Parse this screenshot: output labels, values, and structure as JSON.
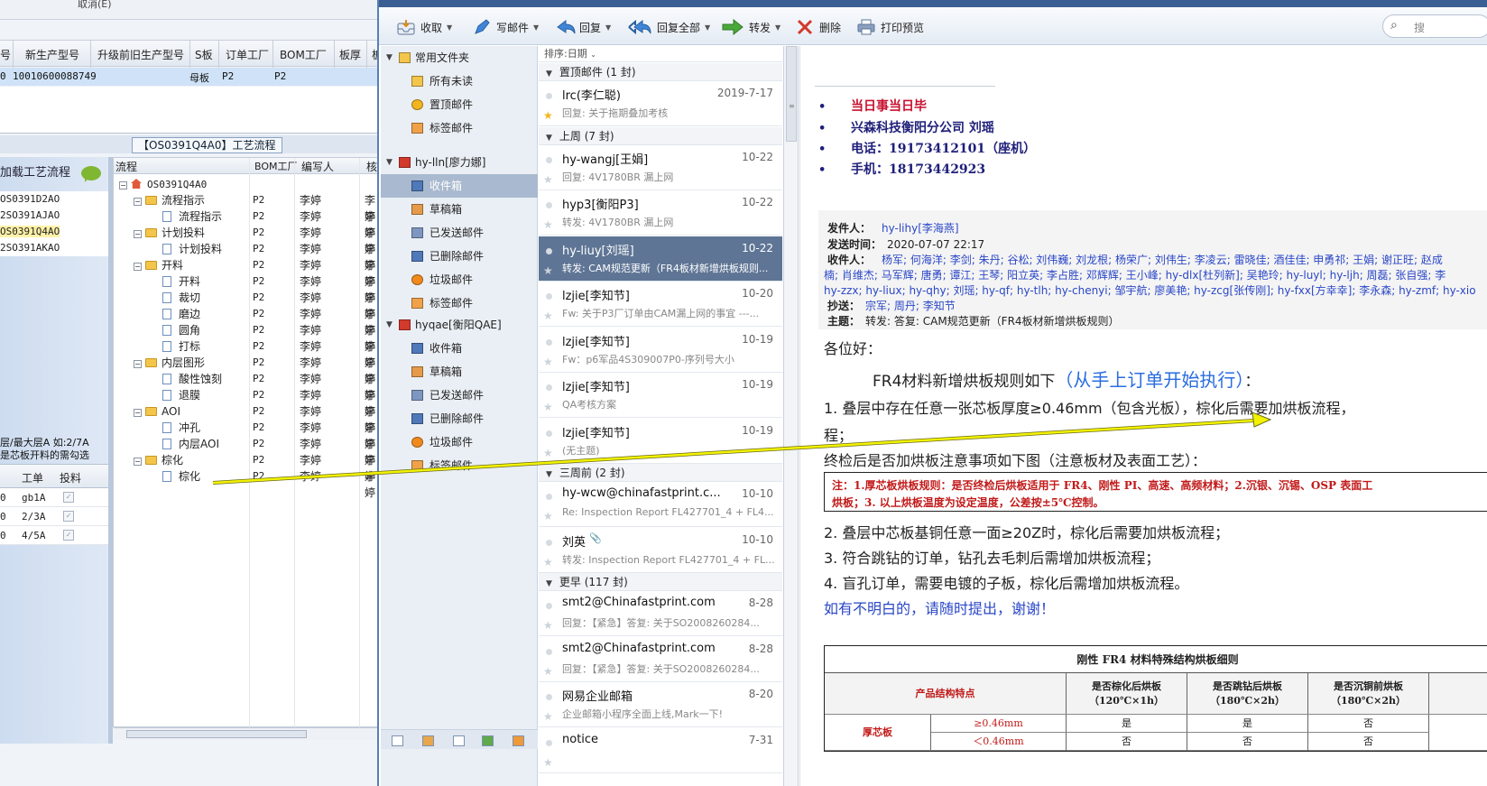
{
  "erp": {
    "top_cut_label": "取消(E)",
    "grid_headers": [
      "号",
      "新生产型号",
      "升级前旧生产型号",
      "S板",
      "订单工厂",
      "BOM工厂",
      "板厚",
      "板"
    ],
    "grid_row": {
      "c0": "0",
      "model": "10010600088749",
      "s_board": "母板",
      "order_factory": "P2",
      "bom_factory": "P2"
    },
    "process_title": "【OS0391Q4A0】工艺流程",
    "load_process_label": "加载工艺流程",
    "process_list": [
      "OS0391D2AO",
      "2SO391AJAO",
      "OS0391Q4AO",
      "2SO391AKAO"
    ],
    "selected_process": "OS0391Q4AO",
    "note_lines": [
      "层/最大层A 如:2/7A",
      "是芯板开料的需勾选"
    ],
    "layer_table": {
      "headers": [
        "工单",
        "投料"
      ],
      "rows": [
        {
          "c0": "0",
          "order": "gb1A",
          "check": "✓"
        },
        {
          "c0": "0",
          "order": "2/3A",
          "check": "✓"
        },
        {
          "c0": "0",
          "order": "4/5A",
          "check": "✓"
        }
      ]
    },
    "tree_headers": [
      "流程",
      "BOM工厂",
      "编写人",
      "核"
    ],
    "tree": [
      {
        "level": 0,
        "type": "root",
        "name": "OS0391Q4A0",
        "factory": "",
        "writer": "",
        "checker": ""
      },
      {
        "level": 1,
        "type": "folder",
        "name": "流程指示",
        "factory": "P2",
        "writer": "李婷",
        "checker": "李婷"
      },
      {
        "level": 2,
        "type": "doc",
        "name": "流程指示",
        "factory": "P2",
        "writer": "李婷",
        "checker": "李婷"
      },
      {
        "level": 1,
        "type": "folder",
        "name": "计划投料",
        "factory": "P2",
        "writer": "李婷",
        "checker": "李婷"
      },
      {
        "level": 2,
        "type": "doc",
        "name": "计划投料",
        "factory": "P2",
        "writer": "李婷",
        "checker": "李婷"
      },
      {
        "level": 1,
        "type": "folder",
        "name": "开料",
        "factory": "P2",
        "writer": "李婷",
        "checker": "李婷"
      },
      {
        "level": 2,
        "type": "doc",
        "name": "开料",
        "factory": "P2",
        "writer": "李婷",
        "checker": "李婷"
      },
      {
        "level": 2,
        "type": "doc",
        "name": "裁切",
        "factory": "P2",
        "writer": "李婷",
        "checker": "李婷"
      },
      {
        "level": 2,
        "type": "doc",
        "name": "磨边",
        "factory": "P2",
        "writer": "李婷",
        "checker": "李婷"
      },
      {
        "level": 2,
        "type": "doc",
        "name": "圆角",
        "factory": "P2",
        "writer": "李婷",
        "checker": "李婷"
      },
      {
        "level": 2,
        "type": "doc",
        "name": "打标",
        "factory": "P2",
        "writer": "李婷",
        "checker": "李婷"
      },
      {
        "level": 1,
        "type": "folder",
        "name": "内层图形",
        "factory": "P2",
        "writer": "李婷",
        "checker": "李婷"
      },
      {
        "level": 2,
        "type": "doc",
        "name": "酸性蚀刻",
        "factory": "P2",
        "writer": "李婷",
        "checker": "李婷"
      },
      {
        "level": 2,
        "type": "doc",
        "name": "退膜",
        "factory": "P2",
        "writer": "李婷",
        "checker": "李婷"
      },
      {
        "level": 1,
        "type": "folder",
        "name": "AOI",
        "factory": "P2",
        "writer": "李婷",
        "checker": "李婷"
      },
      {
        "level": 2,
        "type": "doc",
        "name": "冲孔",
        "factory": "P2",
        "writer": "李婷",
        "checker": "李婷"
      },
      {
        "level": 2,
        "type": "doc",
        "name": "内层AOI",
        "factory": "P2",
        "writer": "李婷",
        "checker": "李婷"
      },
      {
        "level": 1,
        "type": "folder",
        "name": "棕化",
        "factory": "P2",
        "writer": "李婷",
        "checker": "李婷"
      },
      {
        "level": 2,
        "type": "doc",
        "name": "棕化",
        "factory": "P2",
        "writer": "李婷",
        "checker": "李婷"
      }
    ]
  },
  "foxmail": {
    "title": "Foxmail",
    "toolbar": [
      {
        "name": "receive",
        "label": "收取",
        "icon": "inbox-tray-icon",
        "dropdown": true
      },
      {
        "name": "compose",
        "label": "写邮件",
        "icon": "pen-icon",
        "dropdown": true
      },
      {
        "name": "reply",
        "label": "回复",
        "icon": "reply-arrow-icon",
        "dropdown": true
      },
      {
        "name": "reply-all",
        "label": "回复全部",
        "icon": "reply-all-icon",
        "dropdown": true
      },
      {
        "name": "forward",
        "label": "转发",
        "icon": "forward-arrow-icon",
        "dropdown": true
      },
      {
        "name": "delete",
        "label": "删除",
        "icon": "delete-x-icon",
        "dropdown": false
      },
      {
        "name": "print-preview",
        "label": "打印预览",
        "icon": "printer-icon",
        "dropdown": false
      }
    ],
    "search_placeholder": "搜",
    "folders": [
      {
        "label": "常用文件夹",
        "indent": 0,
        "icon": "folder-icon",
        "group": true
      },
      {
        "label": "所有未读",
        "indent": 1,
        "icon": "folder-icon"
      },
      {
        "label": "置顶邮件",
        "indent": 1,
        "icon": "star-icon"
      },
      {
        "label": "标签邮件",
        "indent": 1,
        "icon": "tag-icon"
      },
      {
        "label": "hy-lln[廖力娜]",
        "indent": 0,
        "icon": "account-icon",
        "group": true
      },
      {
        "label": "收件箱",
        "indent": 1,
        "icon": "inbox-icon",
        "selected": true
      },
      {
        "label": "草稿箱",
        "indent": 1,
        "icon": "drafts-icon"
      },
      {
        "label": "已发送邮件",
        "indent": 1,
        "icon": "sent-icon"
      },
      {
        "label": "已删除邮件",
        "indent": 1,
        "icon": "trash-icon"
      },
      {
        "label": "垃圾邮件",
        "indent": 1,
        "icon": "junk-fire-icon"
      },
      {
        "label": "标签邮件",
        "indent": 1,
        "icon": "tag-icon"
      },
      {
        "label": "hyqae[衡阳QAE]",
        "indent": 0,
        "icon": "account-icon",
        "group": true
      },
      {
        "label": "收件箱",
        "indent": 1,
        "icon": "inbox-icon"
      },
      {
        "label": "草稿箱",
        "indent": 1,
        "icon": "drafts-icon"
      },
      {
        "label": "已发送邮件",
        "indent": 1,
        "icon": "sent-icon"
      },
      {
        "label": "已删除邮件",
        "indent": 1,
        "icon": "trash-icon"
      },
      {
        "label": "垃圾邮件",
        "indent": 1,
        "icon": "junk-fire-icon"
      },
      {
        "label": "标签邮件",
        "indent": 1,
        "icon": "tag-icon"
      }
    ],
    "sort_label": "排序:日期",
    "message_groups": [
      {
        "label": "置顶邮件 (1 封)",
        "messages": [
          {
            "from": "lrc(李仁聪)",
            "date": "2019-7-17",
            "subject": "回复: 关于拖期叠加考核",
            "starred": true
          }
        ]
      },
      {
        "label": "上周 (7 封)",
        "messages": [
          {
            "from": "hy-wangj[王娟]",
            "date": "10-22",
            "subject": "回复: 4V1780BR    漏上网"
          },
          {
            "from": "hyp3[衡阳P3]",
            "date": "10-22",
            "subject": "转发: 4V1780BR    漏上网"
          },
          {
            "from": "hy-liuy[刘瑶]",
            "date": "10-22",
            "subject": "转发: CAM规范更新（FR4板材新增烘板规则...",
            "selected": true
          },
          {
            "from": "lzjie[李知节]",
            "date": "10-20",
            "subject": "Fw: 关于P3厂订单由CAM漏上网的事宜 ---..."
          },
          {
            "from": "lzjie[李知节]",
            "date": "10-19",
            "subject": "Fw：p6军品4S309007P0-序列号大小"
          },
          {
            "from": "lzjie[李知节]",
            "date": "10-19",
            "subject": "QA考核方案"
          },
          {
            "from": "lzjie[李知节]",
            "date": "10-19",
            "subject": "(无主题)"
          }
        ]
      },
      {
        "label": "三周前 (2 封)",
        "messages": [
          {
            "from": "hy-wcw@chinafastprint.c...",
            "date": "10-10",
            "subject": "Re: Inspection Report FL427701_4 + FL4..."
          },
          {
            "from": "刘英",
            "date": "10-10",
            "subject": "转发: Inspection Report FL427701_4 + FL...",
            "attachment": true
          }
        ]
      },
      {
        "label": "更早 (117 封)",
        "messages": [
          {
            "from": "smt2@Chinafastprint.com",
            "date": "8-28",
            "subject": "回复：【紧急】答复: 关于SO2008260284..."
          },
          {
            "from": "smt2@Chinafastprint.com",
            "date": "8-28",
            "subject": "回复：【紧急】答复: 关于SO2008260284..."
          },
          {
            "from": "网易企业邮箱",
            "date": "8-20",
            "subject": "企业邮箱小程序全面上线,Mark一下!"
          },
          {
            "from": "notice",
            "date": "7-31",
            "subject": ""
          }
        ]
      }
    ],
    "reader": {
      "signature": [
        "当日事当日毕",
        "兴森科技衡阳分公司 刘瑶",
        "电话：19173412101（座机）",
        "手机：18173442923"
      ],
      "header": {
        "from_label": "发件人：",
        "from": "hy-lihy[李海燕]",
        "time_label": "发送时间：",
        "time": "2020-07-07 22:17",
        "to_label": "收件人：",
        "to_line1": "杨军; 何海洋; 李剑; 朱丹; 谷松; 刘伟巍; 刘龙根; 杨荣广; 刘伟生; 李凌云; 雷晓佳; 酒佳佳; 申勇祁; 王娟; 谢正旺; 赵成",
        "to_line2": "楠; 肖维杰; 马军辉; 唐勇; 谭江; 王琴; 阳立英; 李占胜; 邓辉辉; 王小峰; hy-dlx[杜列新]; 吴艳玲; hy-luyl; hy-ljh; 周磊; 张自强; 李",
        "to_line3": "hy-zzx; hy-liux; hy-qhy; 刘瑶; hy-qf; hy-tlh; hy-chenyi; 邹宇航; 廖美艳; hy-zcg[张传刚]; hy-fxx[方幸幸]; 李永森; hy-zmf; hy-xio",
        "cc_label": "抄送：",
        "cc": "宗军; 周丹; 李知节",
        "subject_label": "主题：",
        "subject": "转发: 答复: CAM规范更新（FR4板材新增烘板规则）"
      },
      "greeting": "各位好：",
      "intro_a": "FR4材料新增烘板规则如下",
      "intro_b": "（从手上订单开始执行）",
      "intro_c": "：",
      "rule1_a": "1.  叠层中存在任意一张芯板厚度≥0.46mm（包含光板），棕化后需要加烘板流程，",
      "rule1_b": "程；",
      "rule_note": "终检后是否加烘板注意事项如下图（注意板材及表面工艺）：",
      "box_line1": "注：1.厚芯板烘板规则：是否终检后烘板适用于 FR4、刚性 PI、高速、高频材料；2.沉银、沉锡、OSP 表面工",
      "box_line2": "烘板；3. 以上烘板温度为设定温度，公差按±5℃控制。",
      "rule2": "2.  叠层中芯板基铜任意一面≥20Z时，棕化后需要加烘板流程；",
      "rule3": "3.  符合跳钻的订单，钻孔去毛刺后需增加烘板流程；",
      "rule4": "4.  盲孔订单，需要电镀的子板，棕化后需增加烘板流程。",
      "closing": "如有不明白的，请随时提出，谢谢！",
      "table": {
        "title": "刚性 FR4 材料特殊结构烘板细则",
        "col_feature": "产品结构特点",
        "col1_a": "是否棕化后烘板",
        "col1_b": "（120℃×1h）",
        "col2_a": "是否跳钻后烘板",
        "col2_b": "（180℃×2h）",
        "col3_a": "是否沉铜前烘板",
        "col3_b": "（180℃×2h）",
        "row_label": "厚芯板",
        "r1": {
          "cond": "≥0.46mm",
          "v1": "是",
          "v2": "是",
          "v3": "否"
        },
        "r2": {
          "cond": "＜0.46mm",
          "v1": "否",
          "v2": "否",
          "v3": "否"
        }
      }
    }
  },
  "colors": {
    "accent": "#5f7595",
    "sig_blue": "#1f1f7a",
    "sig_red": "#c8102e",
    "note_red": "#c21a1a",
    "link_blue": "#2a47c7",
    "arrow_yellow": "#f2f200"
  }
}
